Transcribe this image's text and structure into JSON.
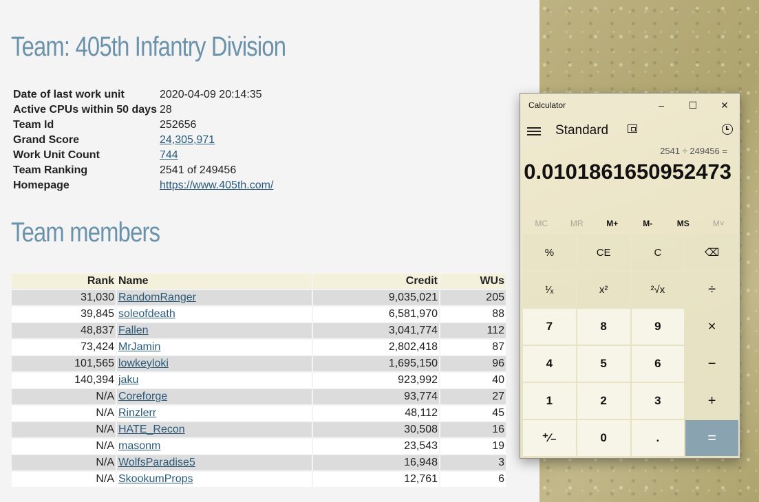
{
  "page": {
    "title": "Team: 405th Infantry Division",
    "members_heading": "Team members",
    "info": [
      {
        "label": "Date of last work unit",
        "value": "2020-04-09 20:14:35",
        "link": false
      },
      {
        "label": "Active CPUs within 50 days",
        "value": "28",
        "link": false
      },
      {
        "label": "Team Id",
        "value": "252656",
        "link": false
      },
      {
        "label": "Grand Score",
        "value": "24,305,971",
        "link": true
      },
      {
        "label": "Work Unit Count",
        "value": "744",
        "link": true
      },
      {
        "label": "Team Ranking",
        "value": "2541 of 249456",
        "link": false
      },
      {
        "label": "Homepage",
        "value": "https://www.405th.com/",
        "link": true
      }
    ],
    "table_headers": {
      "rank": "Rank",
      "name": "Name",
      "credit": "Credit",
      "wus": "WUs"
    },
    "members": [
      {
        "rank": "31,030",
        "name": "RandomRanger",
        "credit": "9,035,021",
        "wus": "205",
        "link": true
      },
      {
        "rank": "39,845",
        "name": "soleofdeath",
        "credit": "6,581,970",
        "wus": "88",
        "link": true
      },
      {
        "rank": "48,837",
        "name": "Fallen",
        "credit": "3,041,774",
        "wus": "112",
        "link": true
      },
      {
        "rank": "73,424",
        "name": "MrJamin",
        "credit": "2,802,418",
        "wus": "87",
        "link": true
      },
      {
        "rank": "101,565",
        "name": "lowkeyloki",
        "credit": "1,695,150",
        "wus": "96",
        "link": true
      },
      {
        "rank": "140,394",
        "name": "jaku",
        "credit": "923,992",
        "wus": "40",
        "link": true
      },
      {
        "rank": "N/A",
        "name": "Coreforge",
        "credit": "93,774",
        "wus": "27",
        "link": true
      },
      {
        "rank": "N/A",
        "name": "Rinzlerr",
        "credit": "48,112",
        "wus": "45",
        "link": true
      },
      {
        "rank": "N/A",
        "name": "HATE_Recon",
        "credit": "30,508",
        "wus": "16",
        "link": true
      },
      {
        "rank": "N/A",
        "name": "masonm",
        "credit": "23,543",
        "wus": "19",
        "link": true
      },
      {
        "rank": "N/A",
        "name": "WolfsParadise5",
        "credit": "16,948",
        "wus": "3",
        "link": true
      },
      {
        "rank": "N/A",
        "name": "SkookumProps",
        "credit": "12,761",
        "wus": "6",
        "link": true
      }
    ],
    "colors": {
      "heading": "#6a92ab",
      "link": "#2a5a7a",
      "row_alt": "#dcdcdc",
      "header_bg": "#f3f1db"
    }
  },
  "calculator": {
    "window_title": "Calculator",
    "mode": "Standard",
    "expression": "2541 ÷ 249456 =",
    "result": "0.0101861650952473",
    "memory": [
      {
        "label": "MC",
        "enabled": false
      },
      {
        "label": "MR",
        "enabled": false
      },
      {
        "label": "M+",
        "enabled": true
      },
      {
        "label": "M-",
        "enabled": true
      },
      {
        "label": "MS",
        "enabled": true
      },
      {
        "label": "M˅",
        "enabled": false
      }
    ],
    "keys": [
      {
        "label": "%",
        "kind": "op",
        "name": "percent-button"
      },
      {
        "label": "CE",
        "kind": "op",
        "name": "clear-entry-button"
      },
      {
        "label": "C",
        "kind": "op",
        "name": "clear-button"
      },
      {
        "label": "⌫",
        "kind": "op",
        "name": "backspace-button"
      },
      {
        "label": "¹⁄ₓ",
        "kind": "op",
        "name": "reciprocal-button"
      },
      {
        "label": "x²",
        "kind": "op",
        "name": "square-button"
      },
      {
        "label": "²√x",
        "kind": "op",
        "name": "square-root-button"
      },
      {
        "label": "÷",
        "kind": "op",
        "name": "divide-button"
      },
      {
        "label": "7",
        "kind": "num",
        "name": "digit-7-button"
      },
      {
        "label": "8",
        "kind": "num",
        "name": "digit-8-button"
      },
      {
        "label": "9",
        "kind": "num",
        "name": "digit-9-button"
      },
      {
        "label": "×",
        "kind": "op",
        "name": "multiply-button"
      },
      {
        "label": "4",
        "kind": "num",
        "name": "digit-4-button"
      },
      {
        "label": "5",
        "kind": "num",
        "name": "digit-5-button"
      },
      {
        "label": "6",
        "kind": "num",
        "name": "digit-6-button"
      },
      {
        "label": "−",
        "kind": "op",
        "name": "subtract-button"
      },
      {
        "label": "1",
        "kind": "num",
        "name": "digit-1-button"
      },
      {
        "label": "2",
        "kind": "num",
        "name": "digit-2-button"
      },
      {
        "label": "3",
        "kind": "num",
        "name": "digit-3-button"
      },
      {
        "label": "+",
        "kind": "op",
        "name": "add-button"
      },
      {
        "label": "⁺⁄₋",
        "kind": "num",
        "name": "negate-button"
      },
      {
        "label": "0",
        "kind": "num",
        "name": "digit-0-button"
      },
      {
        "label": ".",
        "kind": "num",
        "name": "decimal-button"
      },
      {
        "label": "=",
        "kind": "eq",
        "name": "equals-button"
      }
    ],
    "accent": "#8aa3b0"
  }
}
